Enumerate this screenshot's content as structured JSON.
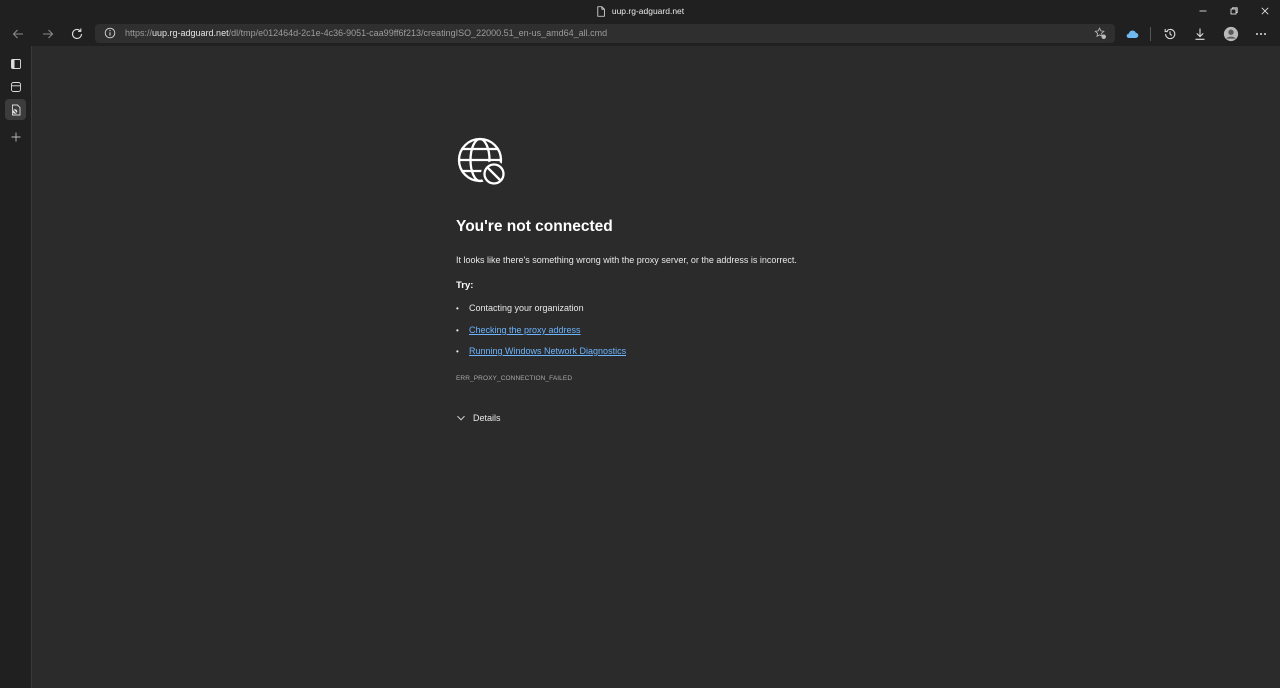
{
  "window": {
    "title": "uup.rg-adguard.net",
    "controls": [
      "minimize",
      "restore",
      "close"
    ]
  },
  "toolbar": {
    "url_prefix": "https://",
    "url_host": "uup.rg-adguard.net",
    "url_path": "/dl/tmp/e012464d-2c1e-4c36-9051-caa99ff6f213/creatingISO_22000.51_en-us_amd64_all.cmd",
    "icons": [
      "back-icon",
      "forward-icon",
      "refresh-icon",
      "site-info-icon",
      "add-favorite-icon",
      "cloud-icon",
      "history-icon",
      "download-icon",
      "profile-icon",
      "more-icon"
    ]
  },
  "sidebar": {
    "items": [
      "tab-actions-icon",
      "collections-icon",
      "current-tab-icon",
      "add-tab-icon"
    ]
  },
  "error": {
    "icon": "globe-blocked-icon",
    "title": "You're not connected",
    "description": "It looks like there's something wrong with the proxy server, or the address is incorrect.",
    "try_label": "Try:",
    "suggestions": [
      {
        "text": "Contacting your organization",
        "link": false
      },
      {
        "text": "Checking the proxy address",
        "link": true
      },
      {
        "text": "Running Windows Network Diagnostics",
        "link": true
      }
    ],
    "code": "ERR_PROXY_CONNECTION_FAILED",
    "details_label": "Details"
  },
  "colors": {
    "page_bg": "#2b2b2b",
    "chrome_bg": "#202020",
    "link": "#6cb4ff",
    "cloud": "#6fb8f0"
  }
}
